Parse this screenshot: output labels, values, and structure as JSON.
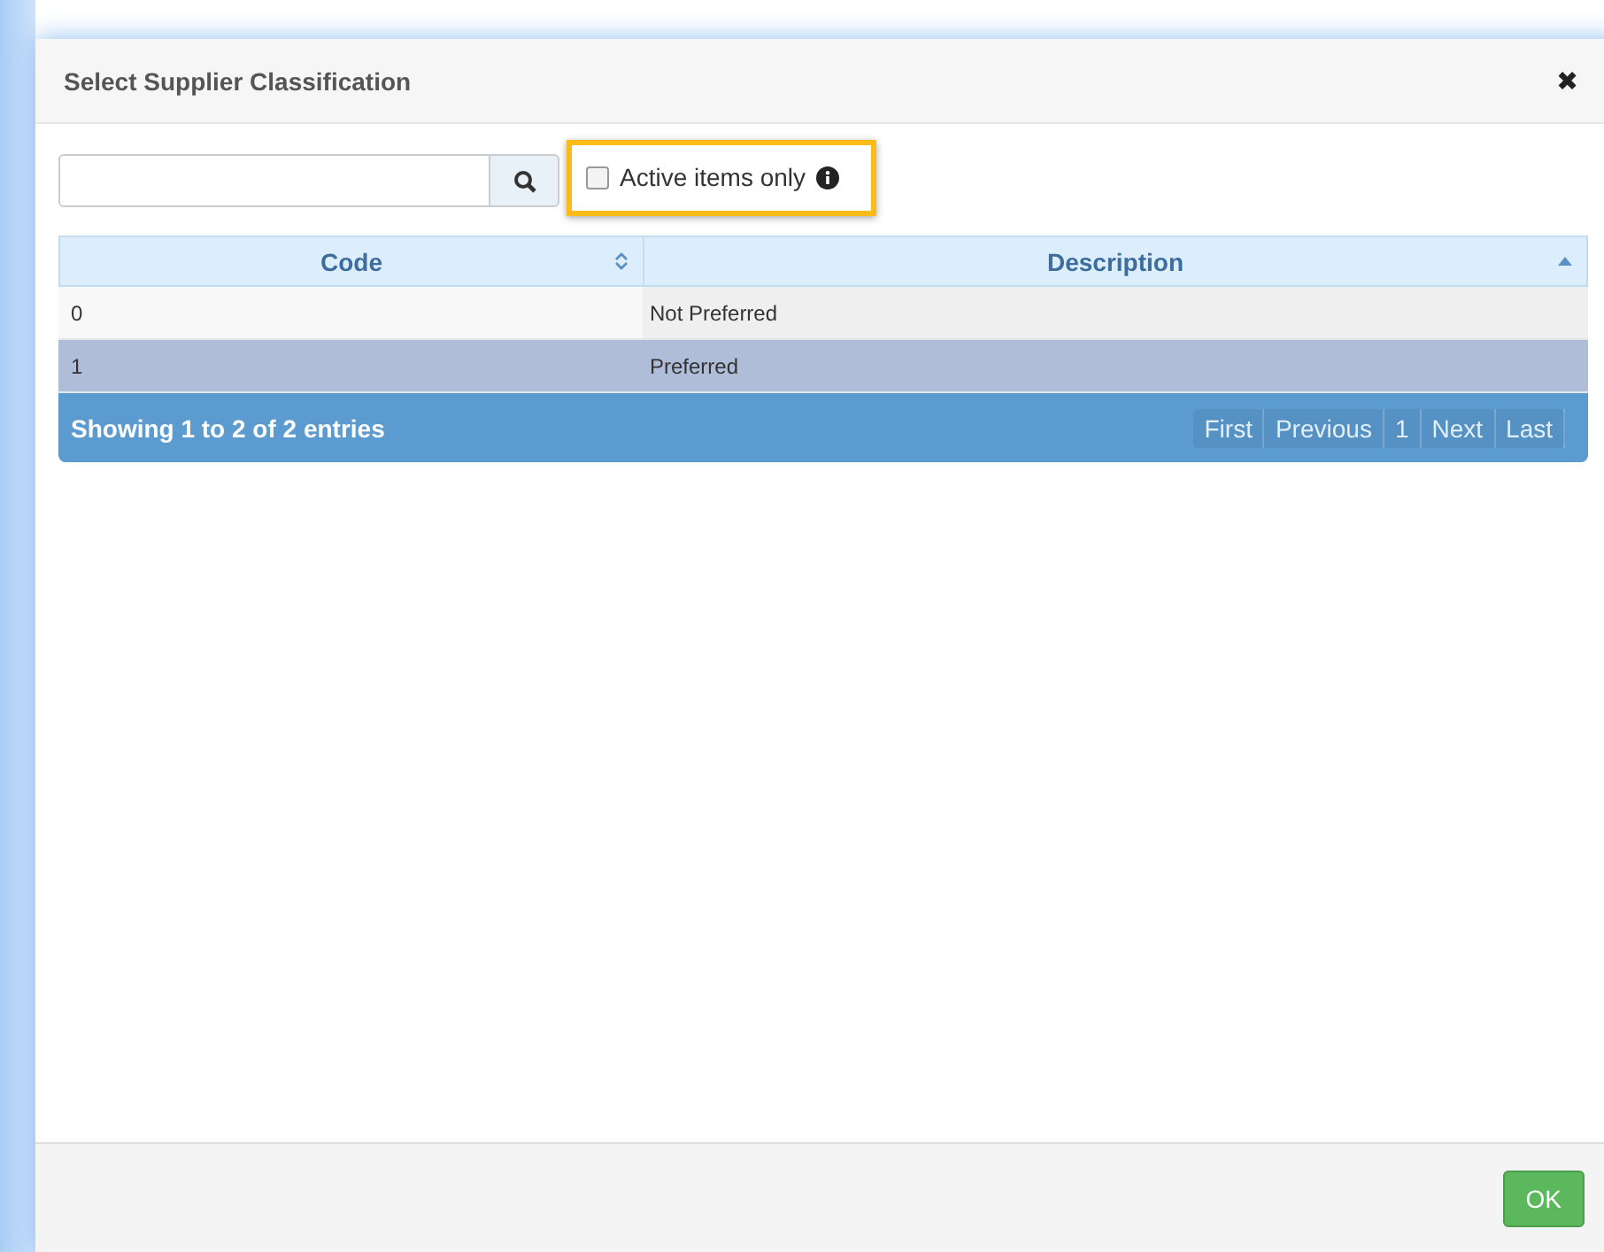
{
  "dialog": {
    "title": "Select Supplier Classification",
    "close": "✖"
  },
  "filter": {
    "label": "Active items only",
    "checked": false,
    "highlighted": true
  },
  "table": {
    "columns": [
      {
        "label": "Code",
        "sorted": false
      },
      {
        "label": "Description",
        "sorted": true
      }
    ],
    "rows": [
      {
        "cells": [
          "0",
          "Not Preferred"
        ],
        "selected": false
      },
      {
        "cells": [
          "1",
          "Preferred"
        ],
        "selected": true
      }
    ]
  },
  "footer_info": "Showing 1 to 2 of 2 entries",
  "pagination": [
    {
      "label": "First",
      "disabled": true
    },
    {
      "label": "Previous",
      "disabled": true
    },
    {
      "label": "1",
      "disabled": true
    },
    {
      "label": "Next",
      "disabled": true
    },
    {
      "label": "Last",
      "disabled": true
    }
  ],
  "buttons": [
    {
      "label": "OK"
    }
  ]
}
